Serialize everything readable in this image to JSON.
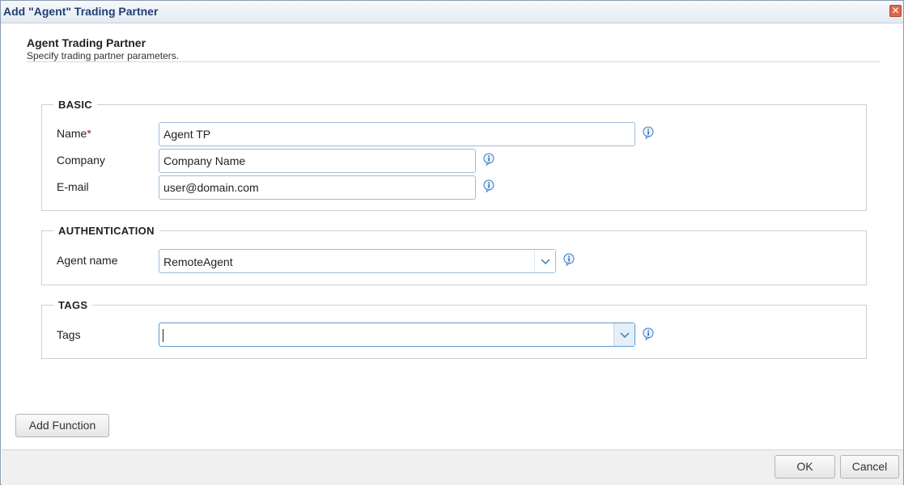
{
  "window": {
    "title": "Add \"Agent\" Trading Partner",
    "close_label": "✕"
  },
  "header": {
    "title": "Agent Trading Partner",
    "subtitle": "Specify trading partner parameters."
  },
  "basic": {
    "legend": "BASIC",
    "name_label": "Name",
    "name_required": "*",
    "name_value": "Agent TP",
    "company_label": "Company",
    "company_value": "Company Name",
    "email_label": "E-mail",
    "email_value": "user@domain.com"
  },
  "authentication": {
    "legend": "AUTHENTICATION",
    "agent_label": "Agent name",
    "agent_value": "RemoteAgent"
  },
  "tags": {
    "legend": "TAGS",
    "tags_label": "Tags",
    "tags_value": ""
  },
  "buttons": {
    "add_function": "Add Function",
    "ok": "OK",
    "cancel": "Cancel"
  },
  "icons": {
    "info": "info-icon",
    "chevron": "chevron-down-icon",
    "close": "close-icon"
  },
  "colors": {
    "title_text": "#1f3f72",
    "input_border": "#9fbcd6",
    "required": "#d0021b",
    "info_icon": "#3b78c4"
  }
}
